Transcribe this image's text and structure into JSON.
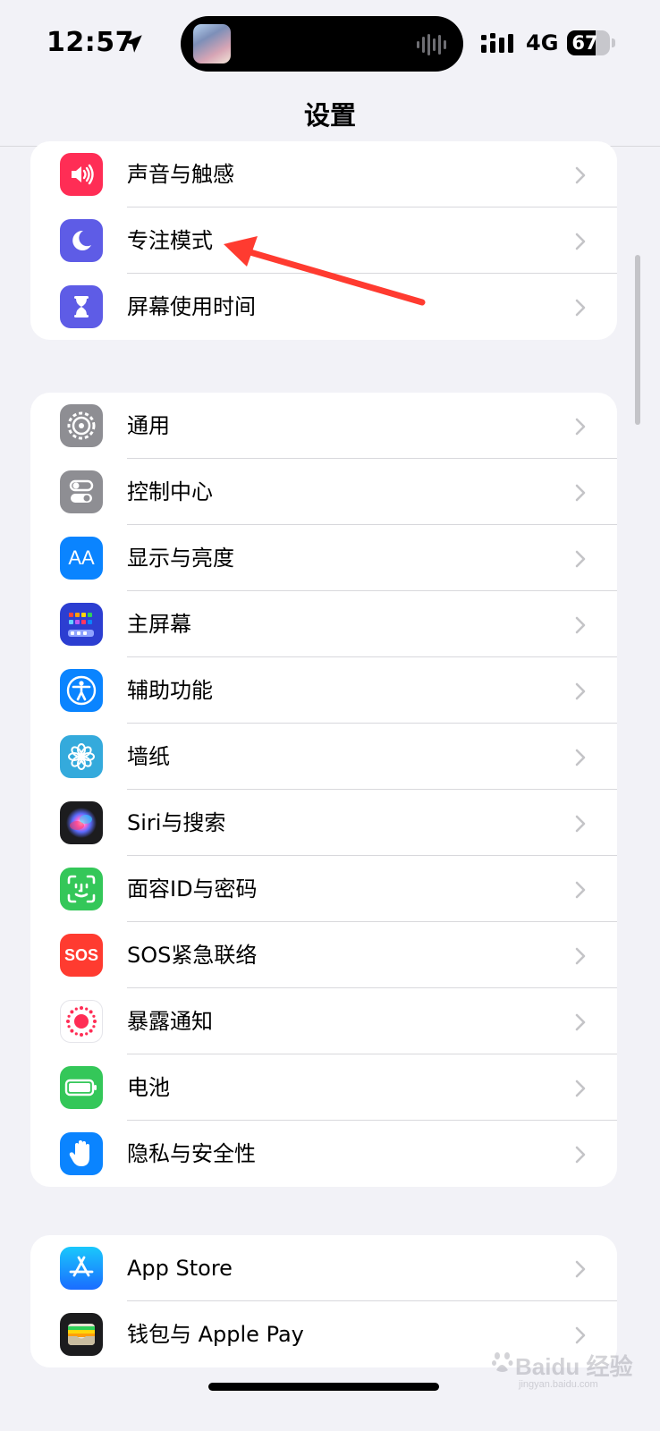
{
  "status_bar": {
    "time": "12:57",
    "network": "4G",
    "battery_level": "67",
    "battery_fraction": 0.67,
    "location_icon": "location-arrow-icon",
    "signal_icon": "cellular-signal-icon"
  },
  "nav": {
    "title": "设置"
  },
  "groups": [
    {
      "items": [
        {
          "label": "声音与触感",
          "icon": "speaker-icon",
          "color": "#ff2d55"
        },
        {
          "label": "专注模式",
          "icon": "moon-icon",
          "color": "#5e5ce6"
        },
        {
          "label": "屏幕使用时间",
          "icon": "hourglass-icon",
          "color": "#5e5ce6"
        }
      ]
    },
    {
      "items": [
        {
          "label": "通用",
          "icon": "gear-icon",
          "color": "#8e8e93"
        },
        {
          "label": "控制中心",
          "icon": "toggles-icon",
          "color": "#8e8e93"
        },
        {
          "label": "显示与亮度",
          "icon": "text-size-icon",
          "icon_text": "AA",
          "color": "#0a84ff"
        },
        {
          "label": "主屏幕",
          "icon": "home-screen-grid-icon",
          "color": "#2c3ed1"
        },
        {
          "label": "辅助功能",
          "icon": "accessibility-icon",
          "color": "#0a84ff"
        },
        {
          "label": "墙纸",
          "icon": "flower-icon",
          "color": "#34aadc"
        },
        {
          "label": "Siri与搜索",
          "icon": "siri-orb-icon",
          "color": "#1c1c1e"
        },
        {
          "label": "面容ID与密码",
          "icon": "face-id-icon",
          "color": "#34c759"
        },
        {
          "label": "SOS紧急联络",
          "icon": "sos-icon",
          "icon_text": "SOS",
          "color": "#ff3b30"
        },
        {
          "label": "暴露通知",
          "icon": "exposure-dots-icon",
          "color": "#ffffff"
        },
        {
          "label": "电池",
          "icon": "battery-icon",
          "color": "#34c759"
        },
        {
          "label": "隐私与安全性",
          "icon": "hand-icon",
          "color": "#0a84ff"
        }
      ]
    },
    {
      "items": [
        {
          "label": "App Store",
          "icon": "app-store-icon",
          "color": "#1a8cff"
        },
        {
          "label": "钱包与 Apple Pay",
          "icon": "wallet-icon",
          "color": "#1c1c1e"
        }
      ]
    }
  ],
  "watermark": {
    "text": "Baidu 经验",
    "sub": "jingyan.baidu.com"
  },
  "annotation": {
    "target": "专注模式",
    "icon": "red-arrow-icon",
    "color": "#ff3b30"
  }
}
